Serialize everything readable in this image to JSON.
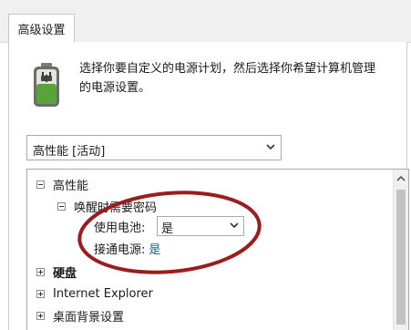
{
  "tab": {
    "label": "高级设置"
  },
  "description": {
    "line1": "选择你要自定义的电源计划，然后选择你希望计算机管理",
    "line2": "的电源设置。"
  },
  "plan_select": {
    "value": "高性能 [活动]"
  },
  "tree": {
    "plan": "高性能",
    "wake_password": "唤醒时需要密码",
    "on_battery_label": "使用电池:",
    "on_battery_value": "是",
    "plugged_in_label": "接通电源:",
    "plugged_in_value": "是",
    "hard_disk": "硬盘",
    "internet_explorer": "Internet Explorer",
    "desktop_background": "桌面背景设置"
  },
  "colors": {
    "annotation_circle": "#9b1c1c",
    "link_value": "#0a6a8a"
  },
  "icons": [
    "battery-plug-icon",
    "chevron-down-icon",
    "scroll-up-arrow-icon",
    "collapse-minus-icon",
    "expand-plus-icon"
  ]
}
